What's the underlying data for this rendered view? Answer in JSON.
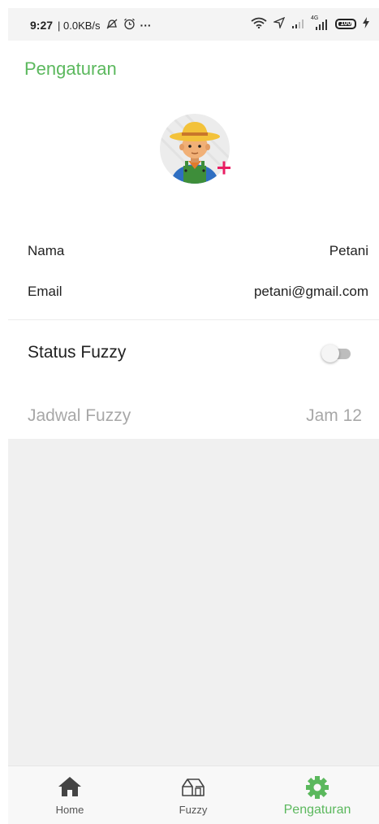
{
  "status_bar": {
    "time": "9:27",
    "network_speed": "| 0.0KB/s",
    "more": "···",
    "network_type": "4G",
    "battery_level": "100",
    "icons": [
      "mute-icon",
      "alarm-icon",
      "wifi-icon",
      "location-icon",
      "signal-icon",
      "battery-icon",
      "charging-icon"
    ]
  },
  "page": {
    "title": "Pengaturan",
    "accent_color": "#5bb85d"
  },
  "profile": {
    "name_label": "Nama",
    "name_value": "Petani",
    "email_label": "Email",
    "email_value": "petani@gmail.com",
    "avatar_icon": "farmer-avatar-icon",
    "add_photo_icon": "plus-icon"
  },
  "settings": {
    "status_fuzzy_label": "Status Fuzzy",
    "status_fuzzy_on": false,
    "jadwal_label": "Jadwal Fuzzy",
    "jadwal_value": "Jam 12"
  },
  "bottom_nav": {
    "items": [
      {
        "label": "Home",
        "icon": "home-icon",
        "active": false
      },
      {
        "label": "Fuzzy",
        "icon": "fuzzy-icon",
        "active": false
      },
      {
        "label": "Pengaturan",
        "icon": "gear-icon",
        "active": true
      }
    ]
  }
}
